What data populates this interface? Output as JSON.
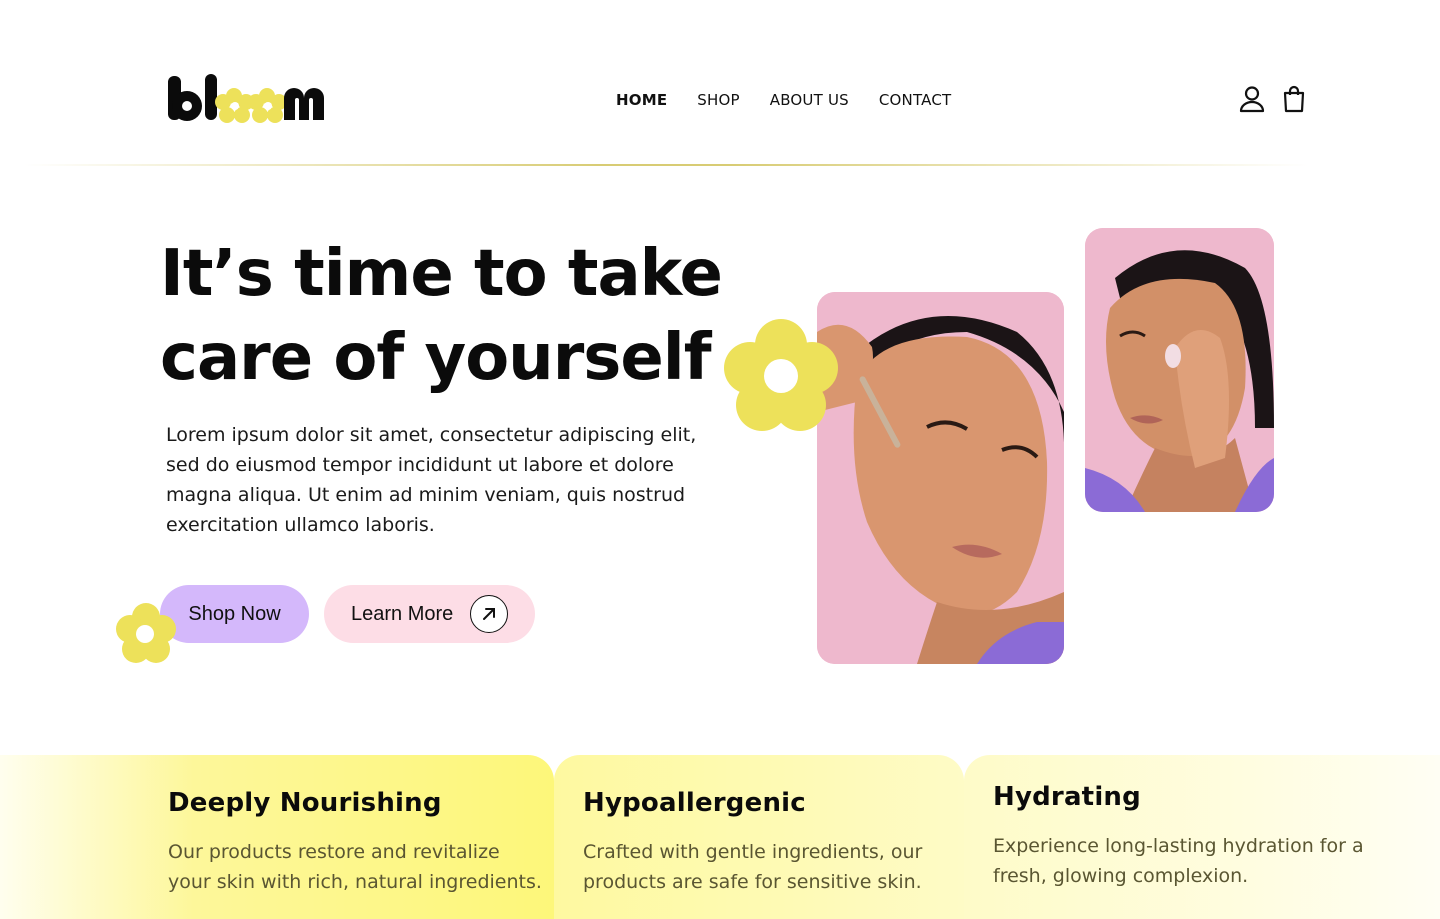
{
  "brand": {
    "name": "bloom",
    "accent_yellow": "#ede15a",
    "purple": "#d4b8fb",
    "pink": "#fddde6"
  },
  "nav": {
    "items": [
      {
        "label": "HOME",
        "active": true
      },
      {
        "label": "SHOP",
        "active": false
      },
      {
        "label": "ABOUT US",
        "active": false
      },
      {
        "label": "CONTACT",
        "active": false
      }
    ],
    "icons": [
      "user-icon",
      "shopping-bag-icon"
    ]
  },
  "hero": {
    "title_line1": "It’s time to take",
    "title_line2": "care of yourself",
    "text": "Lorem ipsum dolor sit amet, consectetur adipiscing elit, sed do eiusmod tempor incididunt ut labore et dolore magna aliqua. Ut enim ad minim veniam, quis nostrud exercitation ullamco laboris.",
    "shop_label": "Shop Now",
    "learn_label": "Learn More"
  },
  "features": [
    {
      "title": "Deeply Nourishing",
      "text": "Our products restore and revitalize your skin with rich, natural ingredients."
    },
    {
      "title": "Hypoallergenic",
      "text": "Crafted with gentle ingredients, our products are safe for sensitive skin."
    },
    {
      "title": "Hydrating",
      "text": "Experience long-lasting hydration for a fresh, glowing complexion."
    }
  ]
}
